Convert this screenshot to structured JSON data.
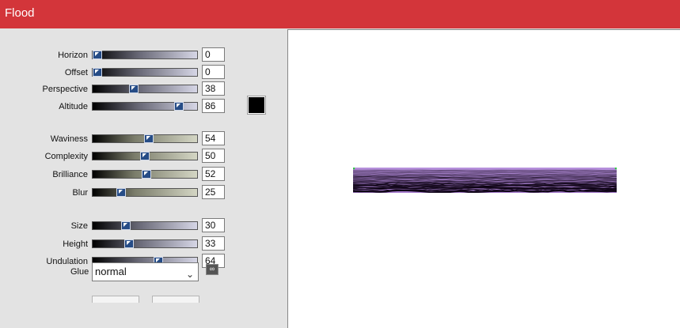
{
  "window": {
    "title": "Flood"
  },
  "colors": {
    "title_bar": "#d3353a",
    "slider_thumb": "#264c86",
    "color_swatch": "#000000",
    "preview_water": "#b48ad4"
  },
  "groups": [
    [
      {
        "label": "Horizon",
        "value": "0",
        "level": 0.0,
        "track": "a"
      },
      {
        "label": "Offset",
        "value": "0",
        "level": 0.0,
        "track": "a"
      },
      {
        "label": "Perspective",
        "value": "38",
        "level": 0.38,
        "track": "a"
      },
      {
        "label": "Altitude",
        "value": "86",
        "level": 0.86,
        "track": "a"
      }
    ],
    [
      {
        "label": "Waviness",
        "value": "54",
        "level": 0.54,
        "track": "b"
      },
      {
        "label": "Complexity",
        "value": "50",
        "level": 0.5,
        "track": "b"
      },
      {
        "label": "Brilliance",
        "value": "52",
        "level": 0.52,
        "track": "b"
      },
      {
        "label": "Blur",
        "value": "25",
        "level": 0.25,
        "track": "b"
      }
    ],
    [
      {
        "label": "Size",
        "value": "30",
        "level": 0.3,
        "track": "a"
      },
      {
        "label": "Height",
        "value": "33",
        "level": 0.33,
        "track": "a"
      },
      {
        "label": "Undulation",
        "value": "64",
        "level": 0.64,
        "track": "a"
      }
    ]
  ],
  "glue": {
    "label": "Glue",
    "value": "normal"
  },
  "icons": {
    "color_swatch": "color-swatch",
    "link": "link-icon",
    "dropdown": "chevron-down-icon"
  }
}
